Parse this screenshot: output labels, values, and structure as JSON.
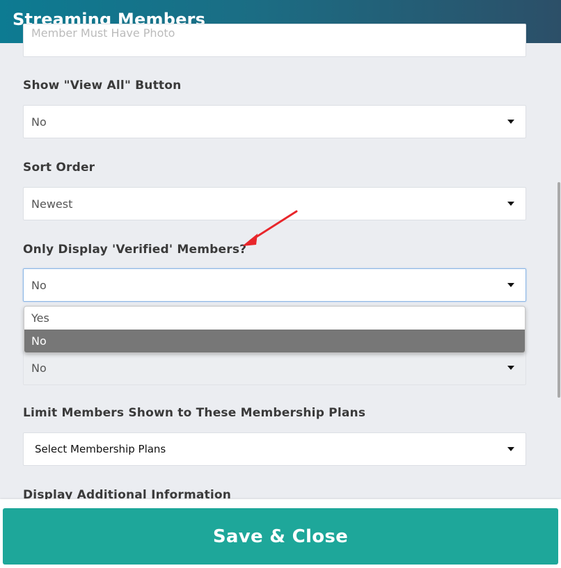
{
  "window": {
    "title": "Streaming Members"
  },
  "fields": [
    {
      "id": "photo_filter",
      "label": "",
      "value": "Member Must Have Photo"
    },
    {
      "id": "show_view_all",
      "label": "Show \"View All\" Button",
      "value": "No"
    },
    {
      "id": "sort_order",
      "label": "Sort Order",
      "value": "Newest"
    },
    {
      "id": "verified_only",
      "label": "Only Display 'Verified' Members?",
      "value": "No",
      "open": true,
      "options": [
        "Yes",
        "No"
      ],
      "highlighted_option": "No"
    },
    {
      "id": "hidden_field",
      "label": "",
      "value": "No"
    },
    {
      "id": "membership_plans",
      "label": "Limit Members Shown to These Membership Plans",
      "value": "Select Membership Plans"
    },
    {
      "id": "additional_info",
      "label": "Display Additional Information",
      "value": ""
    }
  ],
  "footer": {
    "save_label": "Save & Close"
  },
  "colors": {
    "header_gradient_start": "#0d7b92",
    "header_gradient_end": "#2c4f68",
    "save_button": "#1ea79a",
    "selected_option_bg": "#777777",
    "annotation_arrow": "#e8262b",
    "page_background": "#ebedf1"
  },
  "icons": {
    "caret": "caret-down-icon",
    "annotation": "red-arrow-annotation"
  }
}
